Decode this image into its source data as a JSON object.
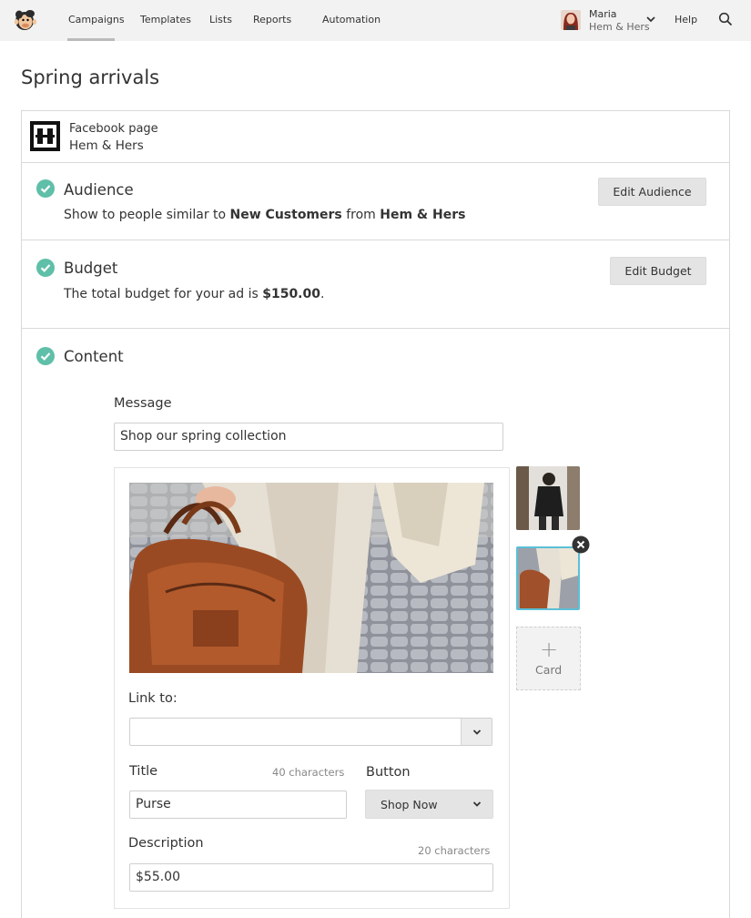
{
  "nav": {
    "items": [
      "Campaigns",
      "Templates",
      "Lists",
      "Reports",
      "Automation"
    ],
    "user_name": "Maria",
    "user_org": "Hem & Hers",
    "help": "Help"
  },
  "page_title": "Spring arrivals",
  "facebook": {
    "label": "Facebook page",
    "name": "Hem & Hers"
  },
  "audience": {
    "title": "Audience",
    "desc_prefix": "Show to people similar to ",
    "desc_bold1": "New Customers",
    "desc_mid": " from ",
    "desc_bold2": "Hem & Hers",
    "button": "Edit Audience"
  },
  "budget": {
    "title": "Budget",
    "desc_prefix": "The total budget for your ad is ",
    "desc_bold": "$150.00",
    "desc_suffix": ".",
    "button": "Edit Budget"
  },
  "content": {
    "title": "Content",
    "message_label": "Message",
    "message_value": "Shop our spring collection",
    "link_label": "Link to:",
    "link_value": "",
    "title_label": "Title",
    "title_counter": "40 characters",
    "title_value": "Purse",
    "button_label": "Button",
    "button_value": "Shop Now",
    "description_label": "Description",
    "description_counter": "20 characters",
    "description_value": "$55.00",
    "add_card_label": "Card",
    "add_card_symbol": "+"
  },
  "colors": {
    "check_teal": "#5fbfa8",
    "selected_border": "#5bbfd6",
    "nav_bg": "#f2f2f2"
  }
}
